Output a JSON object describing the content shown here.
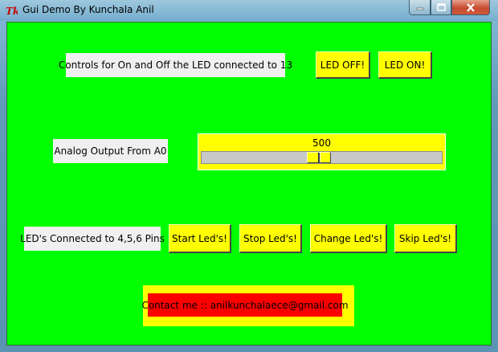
{
  "window": {
    "title": "Gui Demo By Kunchala Anil",
    "icon": "tk-feather-icon",
    "controls": {
      "minimize_icon": "minimize-icon",
      "maximize_icon": "maximize-icon",
      "close_icon": "close-icon"
    }
  },
  "colors": {
    "background": "#00ff00",
    "button": "#ffff00",
    "contact": "#ff0000",
    "label": "#f0f0f0"
  },
  "led13": {
    "label": "Controls for On and Off the LED connected to 13",
    "off_button": "LED OFF!",
    "on_button": "LED ON!"
  },
  "analog": {
    "label": "Analog Output From A0",
    "value": "500",
    "min": 0,
    "max": 1023,
    "level": 500
  },
  "leds": {
    "label": "LED's Connected to 4,5,6 Pins",
    "start_button": "Start Led's!",
    "stop_button": "Stop Led's!",
    "change_button": "Change Led's!",
    "skip_button": "Skip Led's!"
  },
  "contact": {
    "text": "Contact me :: anilkunchalaece@gmail.com"
  }
}
